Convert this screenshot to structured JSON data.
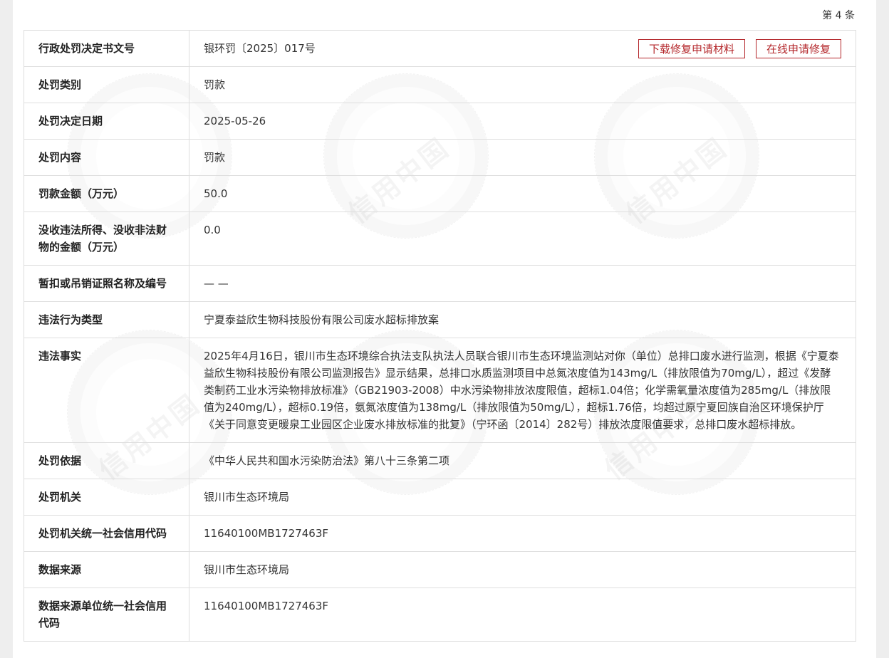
{
  "record_no": "第 4 条",
  "actions": {
    "download_label": "下载修复申请材料",
    "online_label": "在线申请修复"
  },
  "watermark_text": "信用中国",
  "rows": [
    {
      "label": "行政处罚决定书文号",
      "value": "银环罚〔2025〕017号"
    },
    {
      "label": "处罚类别",
      "value": "罚款"
    },
    {
      "label": "处罚决定日期",
      "value": "2025-05-26"
    },
    {
      "label": "处罚内容",
      "value": "罚款"
    },
    {
      "label": "罚款金额（万元）",
      "value": "50.0"
    },
    {
      "label": "没收违法所得、没收非法财物的金额（万元）",
      "value": "0.0"
    },
    {
      "label": "暂扣或吊销证照名称及编号",
      "value": "— —"
    },
    {
      "label": "违法行为类型",
      "value": "宁夏泰益欣生物科技股份有限公司废水超标排放案"
    },
    {
      "label": "违法事实",
      "value": "2025年4月16日，银川市生态环境综合执法支队执法人员联合银川市生态环境监测站对你（单位）总排口废水进行监测，根据《宁夏泰益欣生物科技股份有限公司监测报告》显示结果，总排口水质监测项目中总氮浓度值为143mg/L（排放限值为70mg/L），超过《发酵类制药工业水污染物排放标准》（GB21903-2008）中水污染物排放浓度限值，超标1.04倍；化学需氧量浓度值为285mg/L（排放限值为240mg/L），超标0.19倍，氨氮浓度值为138mg/L（排放限值为50mg/L），超标1.76倍，均超过原宁夏回族自治区环境保护厅《关于同意变更暖泉工业园区企业废水排放标准的批复》（宁环函〔2014〕282号）排放浓度限值要求，总排口废水超标排放。"
    },
    {
      "label": "处罚依据",
      "value": "《中华人民共和国水污染防治法》第八十三条第二项"
    },
    {
      "label": "处罚机关",
      "value": "银川市生态环境局"
    },
    {
      "label": "处罚机关统一社会信用代码",
      "value": "11640100MB1727463F"
    },
    {
      "label": "数据来源",
      "value": "银川市生态环境局"
    },
    {
      "label": "数据来源单位统一社会信用代码",
      "value": "11640100MB1727463F"
    }
  ]
}
